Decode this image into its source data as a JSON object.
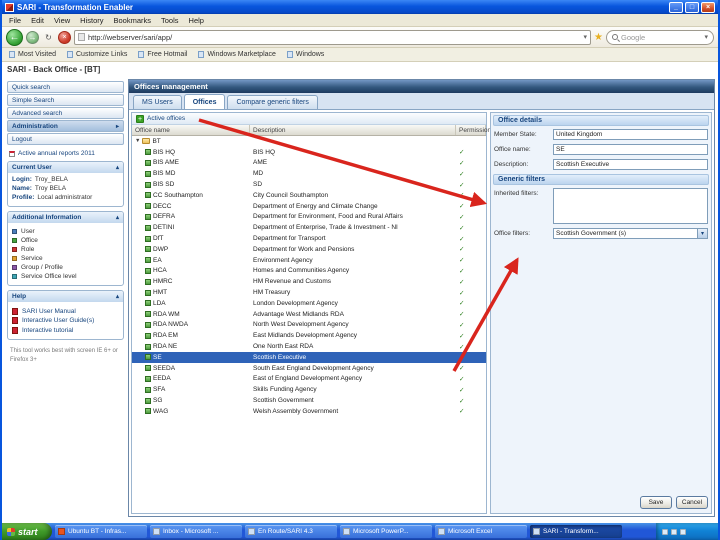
{
  "icons": {
    "minimize": "_",
    "maximize": "□",
    "close": "×",
    "back": "←",
    "forward": "→",
    "refresh": "↻",
    "stop": "×",
    "dropdown": "▾",
    "star": "★",
    "plus": "+",
    "collapse": "▴",
    "expand_open": "▼",
    "submenu": "▸",
    "check": "✓"
  },
  "window": {
    "title": "SARI - Transformation Enabler",
    "menus": [
      "File",
      "Edit",
      "View",
      "History",
      "Bookmarks",
      "Tools",
      "Help"
    ],
    "address": "http://webserver/sari/app/",
    "search_placeholder": "Google",
    "bookmarks": [
      "Most Visited",
      "Customize Links",
      "Free Hotmail",
      "Windows Marketplace",
      "Windows"
    ]
  },
  "page": {
    "title": "SARI - Back Office - [BT]"
  },
  "sidebar": {
    "nav": [
      "Quick search",
      "Simple Search",
      "Advanced search",
      "Administration",
      "Logout"
    ],
    "selected_nav": "Administration",
    "reports_link": "Active annual reports 2011",
    "current_user": {
      "title": "Current User",
      "login_label": "Login:",
      "login": "Troy_BELA",
      "name_label": "Name:",
      "name": "Troy BELA",
      "profile_label": "Profile:",
      "profile": "Local administrator"
    },
    "additional_info": {
      "title": "Additional Information",
      "legend": [
        {
          "label": "User",
          "color": "#4a7ebb"
        },
        {
          "label": "Office",
          "color": "#44a340"
        },
        {
          "label": "Role",
          "color": "#cc3333"
        },
        {
          "label": "Service",
          "color": "#e2a233"
        },
        {
          "label": "Group / Profile",
          "color": "#8b58a8"
        },
        {
          "label": "Service Office level",
          "color": "#3fa7b5"
        }
      ]
    },
    "help": {
      "title": "Help",
      "items": [
        "SARI User Manual",
        "Interactive User Guide(s)",
        "Interactive tutorial"
      ]
    },
    "footnote": "This tool works best with screen IE 6+ or Firefox 3+"
  },
  "main": {
    "header": "Offices management",
    "tabs": [
      {
        "label": "MS Users",
        "active": false
      },
      {
        "label": "Offices",
        "active": true
      },
      {
        "label": "Compare generic filters",
        "active": false
      }
    ],
    "toolbar": {
      "active_label": "Active offices"
    },
    "table": {
      "columns": [
        "Office name",
        "Description",
        "Permissions"
      ],
      "root": {
        "name": "BT"
      },
      "rows": [
        {
          "name": "BIS HQ",
          "desc": "BIS HQ",
          "perm": "✓"
        },
        {
          "name": "BIS AME",
          "desc": "AME",
          "perm": "✓"
        },
        {
          "name": "BIS MD",
          "desc": "MD",
          "perm": "✓"
        },
        {
          "name": "BIS SD",
          "desc": "SD",
          "perm": "✓"
        },
        {
          "name": "CC Southampton",
          "desc": "City Council Southampton",
          "perm": "✓"
        },
        {
          "name": "DECC",
          "desc": "Department of Energy and Climate Change",
          "perm": "✓"
        },
        {
          "name": "DEFRA",
          "desc": "Department for Environment, Food and Rural Affairs",
          "perm": "✓"
        },
        {
          "name": "DETINI",
          "desc": "Department of Enterprise, Trade & Investment - NI",
          "perm": "✓"
        },
        {
          "name": "DfT",
          "desc": "Department for Transport",
          "perm": "✓"
        },
        {
          "name": "DWP",
          "desc": "Department for Work and Pensions",
          "perm": "✓"
        },
        {
          "name": "EA",
          "desc": "Environment Agency",
          "perm": "✓"
        },
        {
          "name": "HCA",
          "desc": "Homes and Communities Agency",
          "perm": "✓"
        },
        {
          "name": "HMRC",
          "desc": "HM Revenue and Customs",
          "perm": "✓"
        },
        {
          "name": "HMT",
          "desc": "HM Treasury",
          "perm": "✓"
        },
        {
          "name": "LDA",
          "desc": "London Development Agency",
          "perm": "✓"
        },
        {
          "name": "RDA WM",
          "desc": "Advantage West Midlands RDA",
          "perm": "✓"
        },
        {
          "name": "RDA NWDA",
          "desc": "North West Development Agency",
          "perm": "✓"
        },
        {
          "name": "RDA EM",
          "desc": "East Midlands Development Agency",
          "perm": "✓"
        },
        {
          "name": "RDA NE",
          "desc": "One North East RDA",
          "perm": "✓"
        },
        {
          "name": "SE",
          "desc": "Scottish Executive",
          "perm": "✓",
          "selected": true
        },
        {
          "name": "SEEDA",
          "desc": "South East England Development Agency",
          "perm": "✓"
        },
        {
          "name": "EEDA",
          "desc": "East of England Development Agency",
          "perm": "✓"
        },
        {
          "name": "SFA",
          "desc": "Skills Funding Agency",
          "perm": "✓"
        },
        {
          "name": "SG",
          "desc": "Scottish Government",
          "perm": "✓"
        },
        {
          "name": "WAG",
          "desc": "Welsh Assembly Government",
          "perm": "✓"
        }
      ]
    }
  },
  "details": {
    "header": "Office details",
    "member_state_label": "Member State:",
    "member_state": "United Kingdom",
    "office_name_label": "Office name:",
    "office_name": "SE",
    "description_label": "Description:",
    "description": "Scottish Executive",
    "generic_header": "Generic filters",
    "inherited_label": "Inherited filters:",
    "office_filters_label": "Office filters:",
    "office_filter_value": "Scottish Government (s)",
    "save_label": "Save",
    "cancel_label": "Cancel"
  },
  "taskbar": {
    "start_label": "start",
    "buttons": [
      {
        "label": "Ubuntu BT - Infras...",
        "active": false
      },
      {
        "label": "Inbox - Microsoft ...",
        "active": false
      },
      {
        "label": "En Route/SARI 4.3",
        "active": false
      },
      {
        "label": "Microsoft PowerP...",
        "active": false
      },
      {
        "label": "Microsoft Excel",
        "active": false
      },
      {
        "label": "SARI - Transform...",
        "active": true
      }
    ],
    "tray_icons": [
      "language-icon",
      "network-icon",
      "volume-icon"
    ]
  }
}
